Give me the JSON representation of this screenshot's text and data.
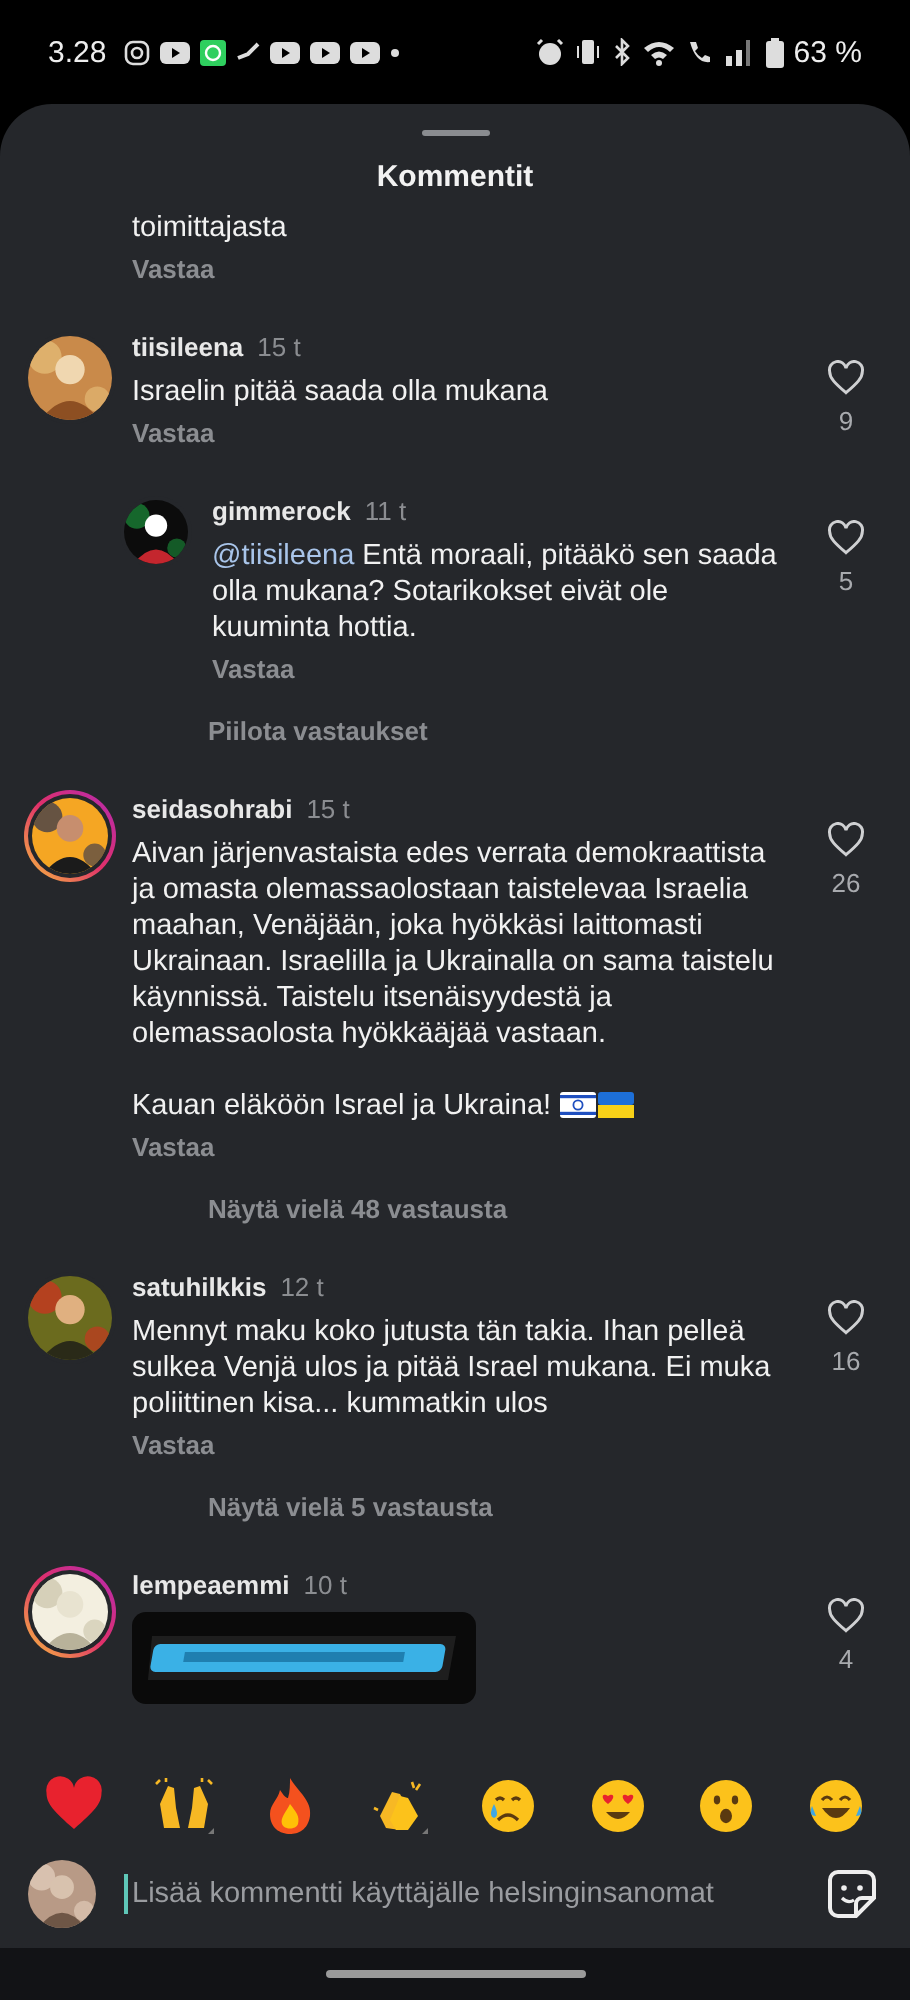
{
  "status_bar": {
    "time": "3.28",
    "battery": "63 %"
  },
  "sheet": {
    "title": "Kommentit"
  },
  "comments": [
    {
      "kind": "fragment",
      "paragraphs": [
        "toimittajasta"
      ],
      "reply_label": "Vastaa"
    },
    {
      "kind": "comment",
      "user": "tiisileena",
      "time": "15 t",
      "paragraphs": [
        "Israelin pitää saada olla mukana"
      ],
      "reply_label": "Vastaa",
      "likes": "9",
      "liked": false,
      "story_ring": false
    },
    {
      "kind": "reply",
      "user": "gimmerock",
      "time": "11 t",
      "mention": "@tiisileena",
      "paragraphs": [
        "Entä moraali, pitääkö sen saada olla mukana? Sotarikokset eivät ole kuuminta hottia."
      ],
      "reply_label": "Vastaa",
      "likes": "5",
      "liked": false,
      "story_ring": false,
      "thread_link": "Piilota vastaukset"
    },
    {
      "kind": "comment",
      "user": "seidasohrabi",
      "time": "15 t",
      "paragraphs": [
        "Aivan järjenvastaista edes verrata demokraattista ja omasta olemassaolostaan taistelevaa Israelia maahan, Venäjään, joka hyökkäsi laittomasti Ukrainaan. Israelilla ja Ukrainalla on sama taistelu käynnissä. Taistelu itsenäisyydestä ja olemassaolosta hyökkääjää vastaan.",
        "Kauan eläköön Israel ja Ukraina!"
      ],
      "flags": true,
      "reply_label": "Vastaa",
      "likes": "26",
      "liked": false,
      "story_ring": true,
      "thread_link": "Näytä vielä 48 vastausta"
    },
    {
      "kind": "comment",
      "user": "satuhilkkis",
      "time": "12 t",
      "paragraphs": [
        "Mennyt maku koko jutusta tän takia. Ihan pelleä sulkea Venjä ulos ja pitää Israel mukana. Ei muka poliittinen kisa... kummatkin ulos"
      ],
      "reply_label": "Vastaa",
      "likes": "16",
      "liked": false,
      "story_ring": false,
      "thread_link": "Näytä vielä 5 vastausta"
    },
    {
      "kind": "comment",
      "user": "lempeaemmi",
      "time": "10 t",
      "likes": "4",
      "liked": false,
      "story_ring": true
    }
  ],
  "composer": {
    "placeholder": "Lisää kommentti käyttäjälle helsinginsanomat"
  }
}
